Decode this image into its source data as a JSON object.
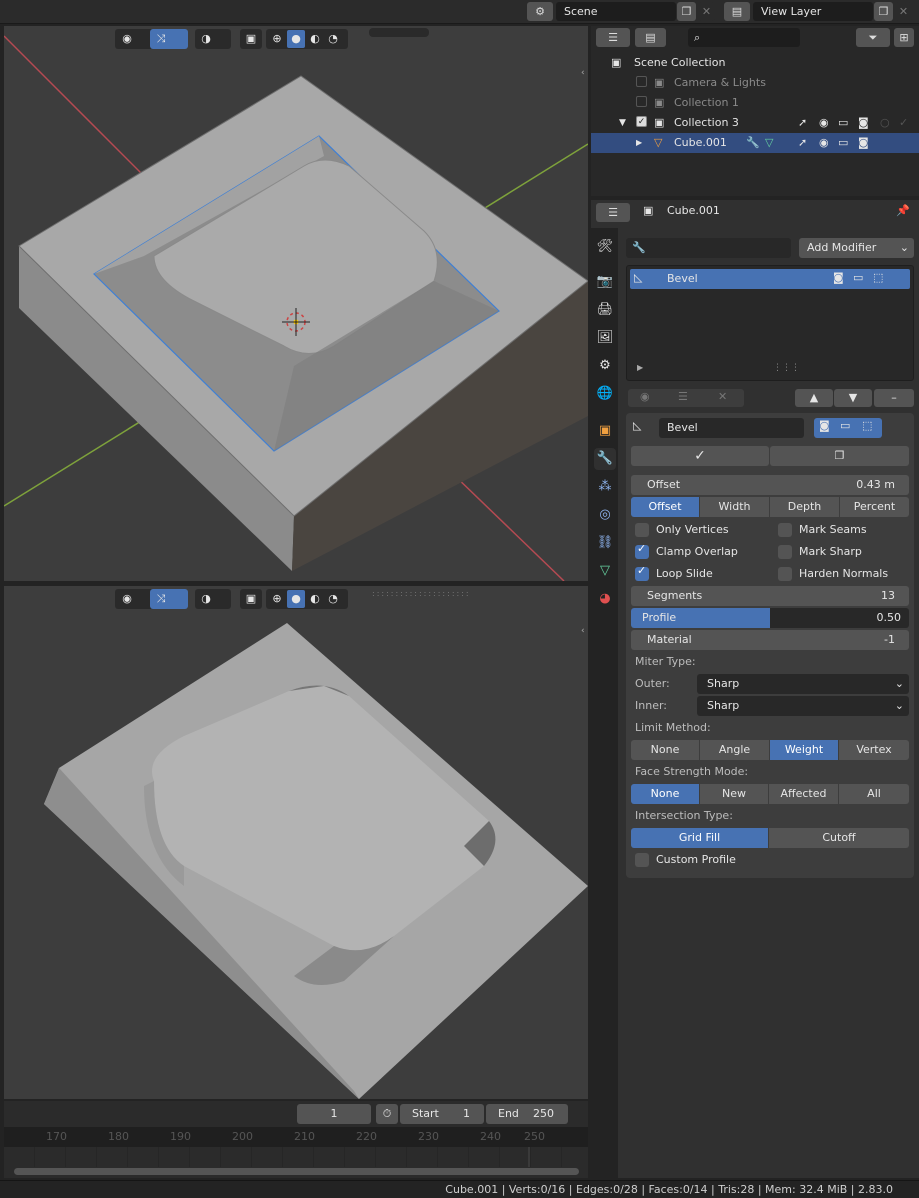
{
  "header": {
    "scene": "Scene",
    "view_layer": "View Layer"
  },
  "outliner": {
    "rows": [
      {
        "label": "Scene Collection"
      },
      {
        "label": "Camera & Lights"
      },
      {
        "label": "Collection 1"
      },
      {
        "label": "Collection 3"
      },
      {
        "label": "Cube.001"
      }
    ]
  },
  "properties": {
    "object_name": "Cube.001",
    "add_modifier": "Add Modifier",
    "modifier_list_item": "Bevel",
    "modifier_name": "Bevel",
    "offset": {
      "label": "Offset",
      "value": "0.43 m"
    },
    "width_type": [
      "Offset",
      "Width",
      "Depth",
      "Percent"
    ],
    "checks": [
      {
        "label": "Only Vertices",
        "checked": false
      },
      {
        "label": "Mark Seams",
        "checked": false
      },
      {
        "label": "Clamp Overlap",
        "checked": true
      },
      {
        "label": "Mark Sharp",
        "checked": false
      },
      {
        "label": "Loop Slide",
        "checked": true
      },
      {
        "label": "Harden Normals",
        "checked": false
      }
    ],
    "segments": {
      "label": "Segments",
      "value": "13"
    },
    "profile": {
      "label": "Profile",
      "value": "0.50",
      "fraction": 0.5
    },
    "material": {
      "label": "Material",
      "value": "-1"
    },
    "miter_type_label": "Miter Type:",
    "outer": {
      "label": "Outer:",
      "value": "Sharp"
    },
    "inner": {
      "label": "Inner:",
      "value": "Sharp"
    },
    "limit_method_label": "Limit Method:",
    "limit_method": [
      "None",
      "Angle",
      "Weight",
      "Vertex Group"
    ],
    "face_strength_label": "Face Strength Mode:",
    "face_strength": [
      "None",
      "New",
      "Affected",
      "All"
    ],
    "intersection_label": "Intersection Type:",
    "intersection": [
      "Grid Fill",
      "Cutoff"
    ],
    "custom_profile": "Custom Profile"
  },
  "timeline": {
    "current_frame": "1",
    "start_label": "Start",
    "start": "1",
    "end_label": "End",
    "end": "250",
    "ticks": [
      "170",
      "180",
      "190",
      "200",
      "210",
      "220",
      "230",
      "240",
      "250"
    ]
  },
  "statusbar": {
    "text": "Cube.001 | Verts:0/16 | Edges:0/28 | Faces:0/14 | Tris:28 | Mem: 32.4 MiB | 2.83.0"
  },
  "colors": {
    "accent": "#4772b3",
    "selected_row": "#334d80",
    "x_axis": "#b54a52",
    "y_axis": "#7ea23b",
    "edge_select": "#3d7fd6"
  }
}
